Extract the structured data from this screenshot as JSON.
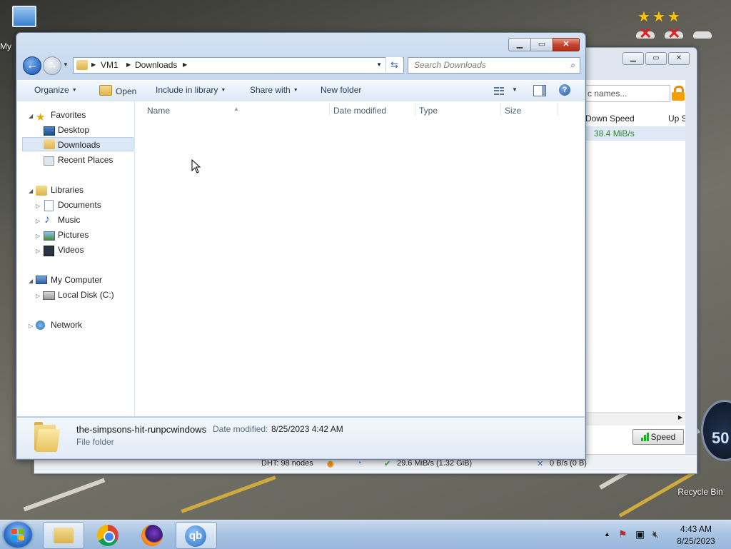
{
  "desktop": {
    "icon_my_label": "My",
    "recycle_bin_label": "Recycle Bin"
  },
  "hud": {
    "stars": 3,
    "speedometer_text": "50"
  },
  "qbittorrent": {
    "search_placeholder": "c names...",
    "col_down_speed": "Down Speed",
    "col_up_speed": "Up S",
    "row_down_speed": "38.4 MiB/s",
    "speed_button": "Speed",
    "status_dht": "DHT: 98 nodes",
    "status_download": "29.6 MiB/s (1.32 GiB)",
    "status_upload": "0 B/s (0 B)"
  },
  "explorer": {
    "breadcrumb": [
      "VM1",
      "Downloads"
    ],
    "search_placeholder": "Search Downloads",
    "toolbar": {
      "organize": "Organize",
      "open": "Open",
      "include_in_library": "Include in library",
      "share_with": "Share with",
      "new_folder": "New folder"
    },
    "nav": {
      "favorites": "Favorites",
      "desktop": "Desktop",
      "downloads": "Downloads",
      "recent_places": "Recent Places",
      "libraries": "Libraries",
      "documents": "Documents",
      "music": "Music",
      "pictures": "Pictures",
      "videos": "Videos",
      "my_computer": "My Computer",
      "local_disk": "Local Disk (C:)",
      "network": "Network"
    },
    "columns": {
      "name": "Name",
      "date_modified": "Date modified",
      "type": "Type",
      "size": "Size"
    },
    "details": {
      "name": "the-simpsons-hit-runpcwindows",
      "date_label": "Date modified:",
      "date_value": "8/25/2023 4:42 AM",
      "type": "File folder"
    }
  },
  "taskbar": {
    "time": "4:43 AM",
    "date": "8/25/2023",
    "qb_label": "qb"
  },
  "colors": {
    "accent": "#2d6bc2",
    "selection": "#dce8f6",
    "down_speed_green": "#2a8a2a"
  }
}
